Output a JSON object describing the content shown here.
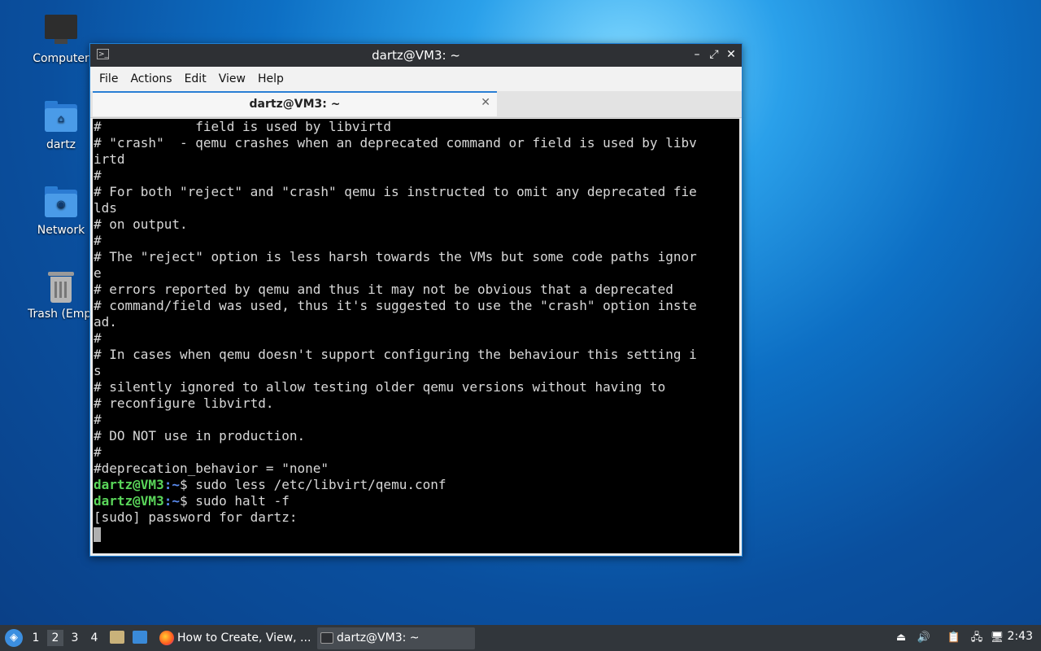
{
  "desktop": {
    "icons": [
      {
        "label": "Computer",
        "icon": "computer-icon"
      },
      {
        "label": "dartz",
        "icon": "home-folder-icon"
      },
      {
        "label": "Network",
        "icon": "network-folder-icon"
      },
      {
        "label": "Trash (Empty)",
        "icon": "trash-icon"
      }
    ]
  },
  "window": {
    "title": "dartz@VM3: ~",
    "controls": {
      "minimize": "–",
      "maximize": "⤢",
      "close": "✕"
    },
    "menu": [
      "File",
      "Actions",
      "Edit",
      "View",
      "Help"
    ],
    "tab": {
      "label": "dartz@VM3: ~",
      "close": "✕"
    }
  },
  "terminal": {
    "lines": [
      "#            field is used by libvirtd",
      "# \"crash\"  - qemu crashes when an deprecated command or field is used by libv",
      "irtd",
      "#",
      "# For both \"reject\" and \"crash\" qemu is instructed to omit any deprecated fie",
      "lds",
      "# on output.",
      "#",
      "# The \"reject\" option is less harsh towards the VMs but some code paths ignor",
      "e",
      "# errors reported by qemu and thus it may not be obvious that a deprecated",
      "# command/field was used, thus it's suggested to use the \"crash\" option inste",
      "ad.",
      "#",
      "# In cases when qemu doesn't support configuring the behaviour this setting i",
      "s",
      "# silently ignored to allow testing older qemu versions without having to",
      "# reconfigure libvirtd.",
      "#",
      "# DO NOT use in production.",
      "#",
      "#deprecation_behavior = \"none\""
    ],
    "prompt_user": "dartz@VM3",
    "prompt_path": ":~",
    "prompt_symbol": "$",
    "cmd1": " sudo less /etc/libvirt/qemu.conf",
    "cmd2": " sudo halt -f",
    "sudo_prompt": "[sudo] password for dartz:"
  },
  "taskbar": {
    "workspaces": [
      "1",
      "2",
      "3",
      "4"
    ],
    "active_workspace": "2",
    "tasks": [
      {
        "label": "How to Create, View, ...",
        "icon": "firefox-icon"
      },
      {
        "label": "dartz@VM3: ~",
        "icon": "terminal-icon"
      }
    ],
    "clock": "2:43"
  },
  "colors": {
    "accent": "#2a7fd4",
    "prompt_user": "#5ad65a",
    "prompt_path": "#5b8cf0"
  }
}
